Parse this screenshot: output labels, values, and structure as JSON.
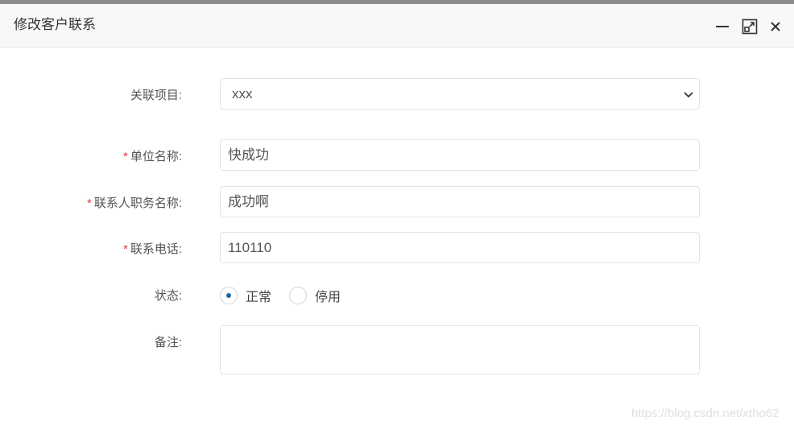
{
  "dialog": {
    "title": "修改客户联系",
    "controls": {
      "minimize_icon": "minimize-icon",
      "maximize_icon": "maximize-icon",
      "close_icon": "close-icon"
    }
  },
  "form": {
    "project": {
      "label": "关联项目:",
      "value": "xxx"
    },
    "unit_name": {
      "label": "单位名称:",
      "required": "*",
      "value": "快成功"
    },
    "contact_title": {
      "label": "联系人职务名称:",
      "required": "*",
      "value": "成功啊"
    },
    "phone": {
      "label": "联系电话:",
      "required": "*",
      "value": "110110"
    },
    "status": {
      "label": "状态:",
      "options": [
        {
          "label": "正常",
          "checked": true
        },
        {
          "label": "停用",
          "checked": false
        }
      ]
    },
    "remark": {
      "label": "备注:",
      "value": ""
    }
  },
  "watermark": "https://blog.csdn.net/xtho62",
  "colors": {
    "required": "#e4393c",
    "radio_accent": "#1e6aa8"
  }
}
